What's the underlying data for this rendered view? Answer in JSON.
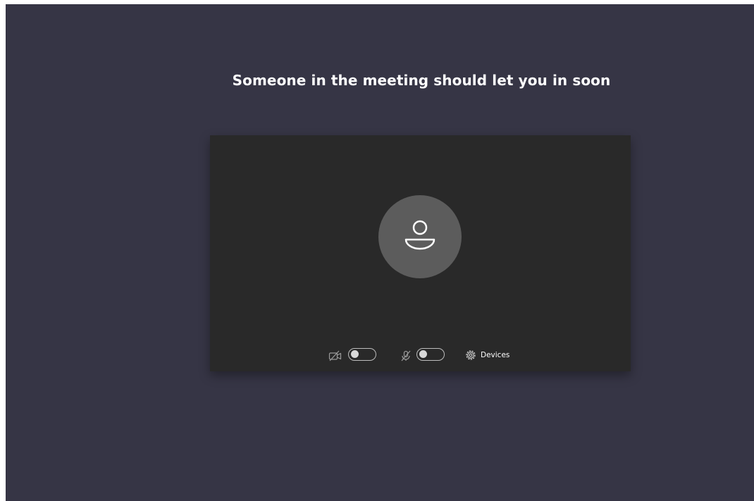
{
  "header": {
    "title": "Someone in the meeting should let you in soon"
  },
  "preview": {
    "avatar_icon": "person-icon",
    "camera_icon": "camera-off-icon",
    "mic_icon": "mic-off-icon",
    "devices_icon": "gear-icon",
    "camera_on": false,
    "mic_on": false,
    "devices_label": "Devices"
  },
  "colors": {
    "background": "#363545",
    "panel": "#292929",
    "avatar": "#5c5c5c",
    "text": "#ffffff"
  }
}
